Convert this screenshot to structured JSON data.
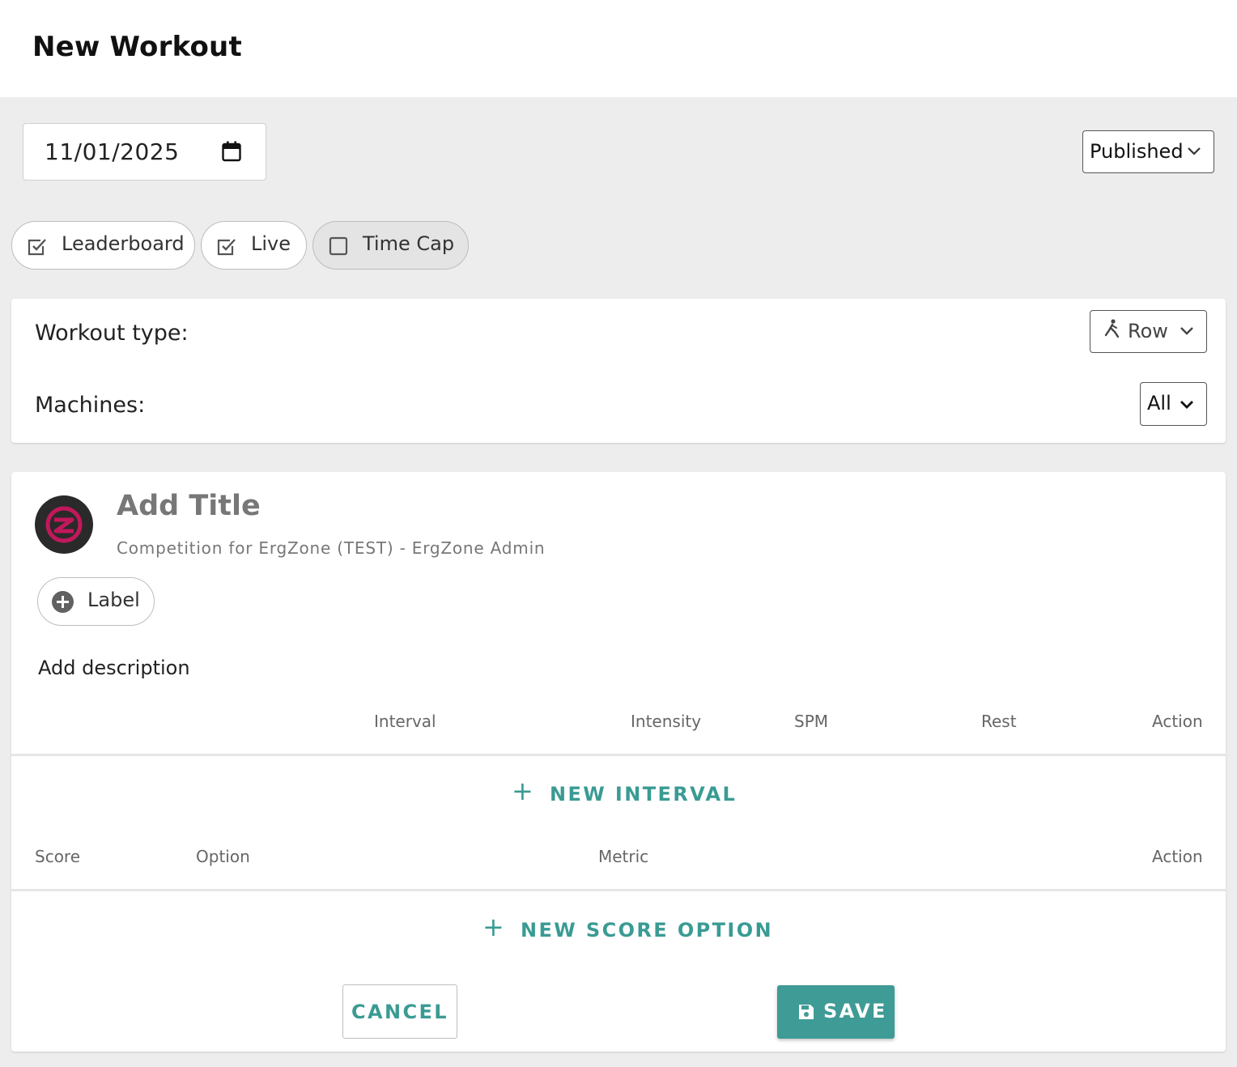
{
  "header": {
    "title": "New Workout"
  },
  "date_field": {
    "value": "11/01/2025",
    "icon": "calendar-icon"
  },
  "status_select": {
    "value": "Published",
    "icon": "chevron-down-icon"
  },
  "chips": [
    {
      "label": "Leaderboard",
      "checked": true
    },
    {
      "label": "Live",
      "checked": true
    },
    {
      "label": "Time Cap",
      "checked": false
    }
  ],
  "workout_settings": {
    "type_label": "Workout type:",
    "type_value": "Row",
    "type_icon": "rowing-icon",
    "machines_label": "Machines:",
    "machines_value": "All"
  },
  "workout": {
    "title_placeholder": "Add Title",
    "subtitle": "Competition for ErgZone (TEST) - ErgZone Admin",
    "label_button": "Label",
    "description_placeholder": "Add description"
  },
  "interval_table": {
    "columns": [
      "Interval",
      "Intensity",
      "SPM",
      "Rest",
      "Action"
    ],
    "add_button": "NEW INTERVAL"
  },
  "score_table": {
    "columns": [
      "Score",
      "Option",
      "Metric",
      "Action"
    ],
    "add_button": "NEW SCORE OPTION"
  },
  "actions": {
    "cancel": "CANCEL",
    "save": "SAVE"
  },
  "colors": {
    "accent": "#3a9b94",
    "background": "#ededed",
    "brand_pink": "#c2185b"
  }
}
